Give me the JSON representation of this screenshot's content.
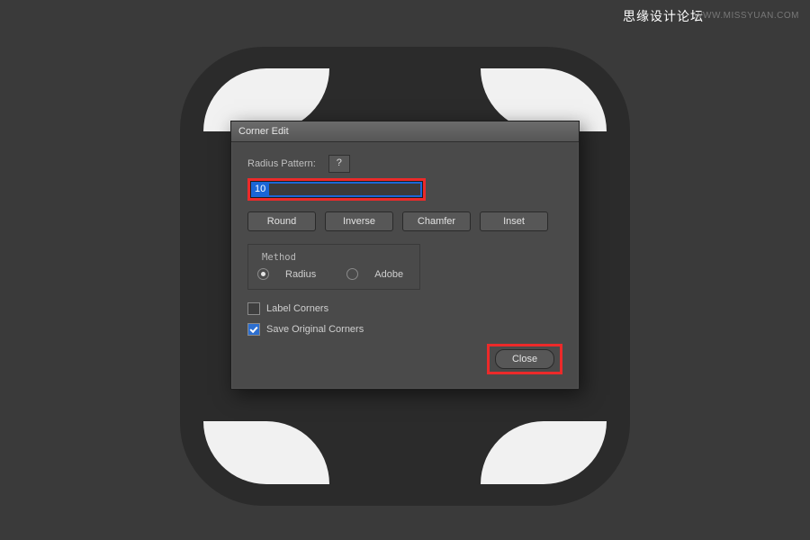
{
  "watermark": {
    "cn": "思缘设计论坛",
    "url": "WWW.MISSYUAN.COM"
  },
  "dialog": {
    "title": "Corner Edit",
    "radius_pattern_label": "Radius Pattern:",
    "help_label": "?",
    "radius_value": "10",
    "buttons": [
      "Round",
      "Inverse",
      "Chamfer",
      "Inset"
    ],
    "method": {
      "legend": "Method",
      "options": [
        "Radius",
        "Adobe"
      ],
      "selected": "Radius"
    },
    "label_corners": "Label Corners",
    "label_corners_checked": false,
    "save_original": "Save Original Corners",
    "save_original_checked": true,
    "close_label": "Close"
  },
  "highlights": [
    "radius-input",
    "close-button"
  ],
  "colors": {
    "highlight_red": "#ec2a2a",
    "selection_blue": "#1a66d6",
    "dialog_bg": "#4a4a4a",
    "canvas_bg": "#3a3a3a",
    "shape_bg": "#2b2b2b"
  }
}
